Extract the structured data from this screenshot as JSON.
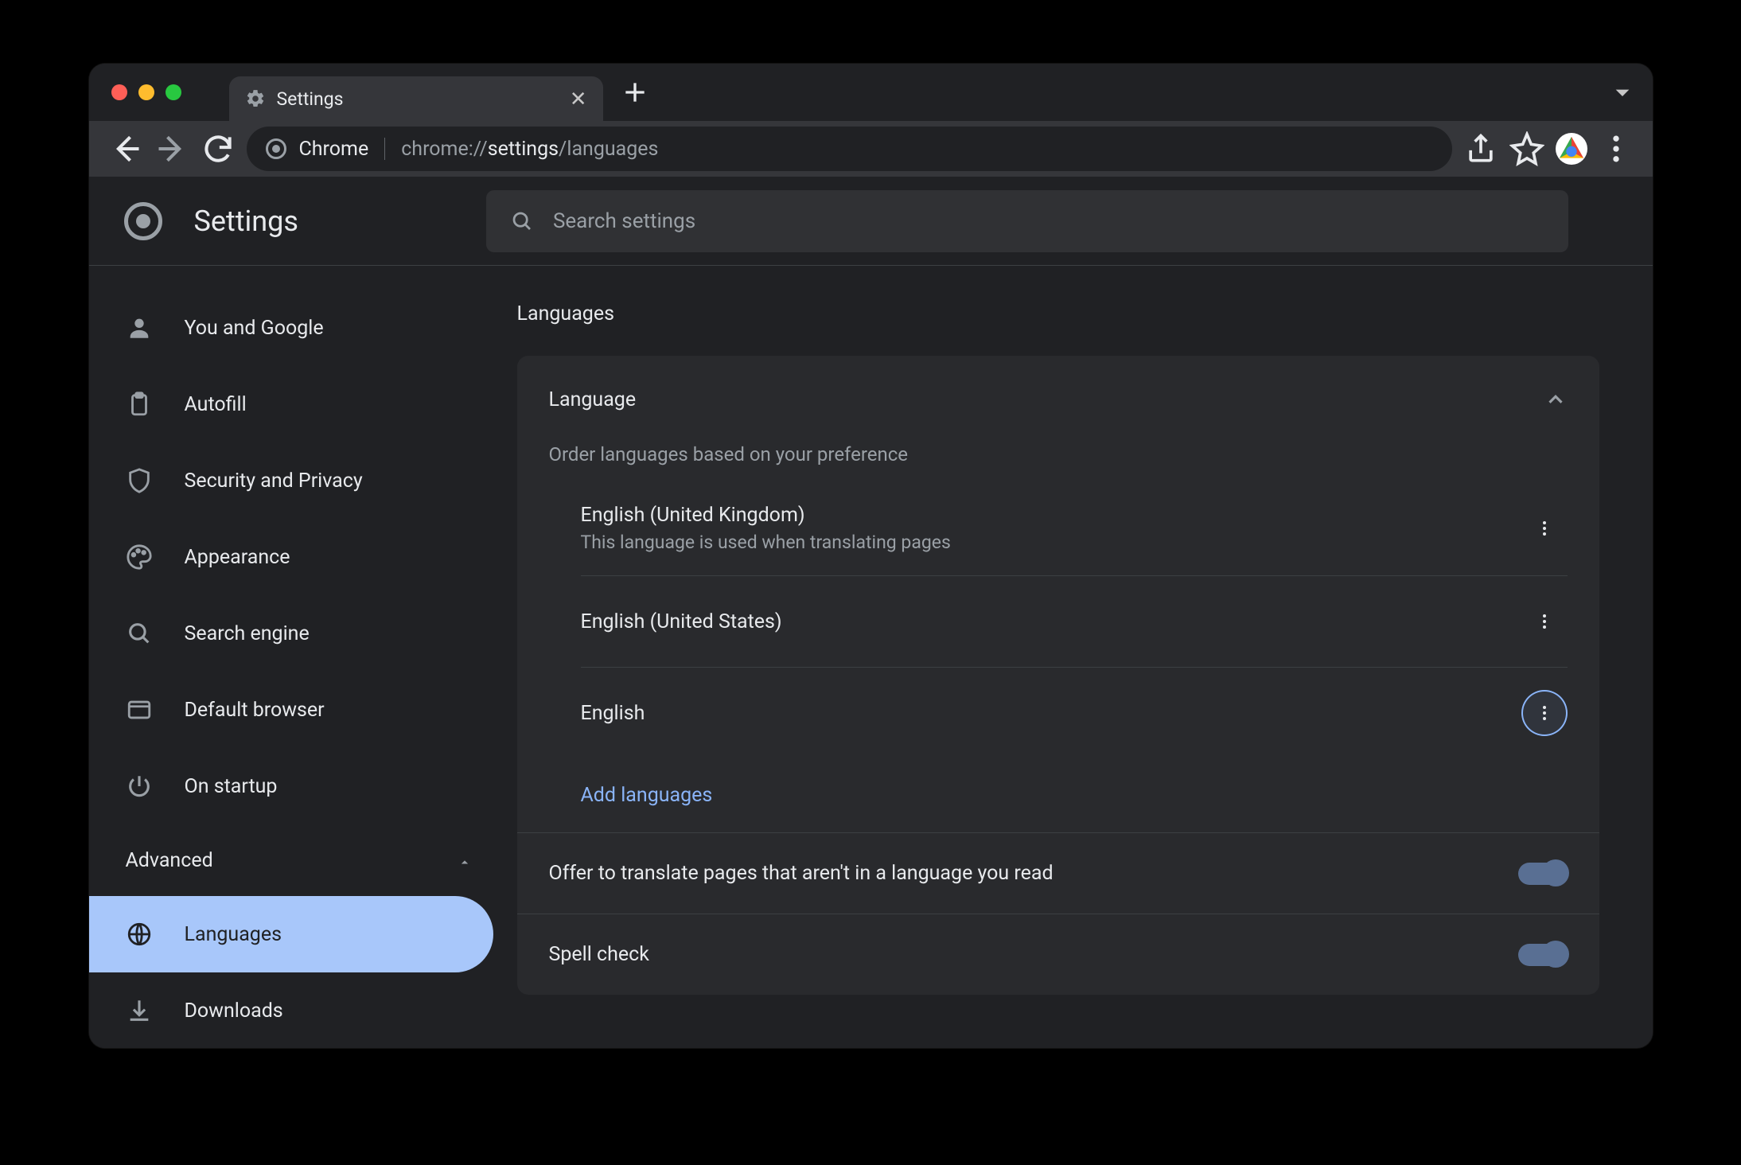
{
  "window": {
    "tab_title": "Settings",
    "new_tab_tooltip": "+"
  },
  "omnibox": {
    "origin_label": "Chrome",
    "url_scheme": "chrome://",
    "url_path_bold": "settings",
    "url_path_tail": "/languages"
  },
  "page": {
    "app_title": "Settings",
    "search_placeholder": "Search settings"
  },
  "sidebar": {
    "items": [
      {
        "label": "You and Google"
      },
      {
        "label": "Autofill"
      },
      {
        "label": "Security and Privacy"
      },
      {
        "label": "Appearance"
      },
      {
        "label": "Search engine"
      },
      {
        "label": "Default browser"
      },
      {
        "label": "On startup"
      }
    ],
    "advanced_label": "Advanced",
    "advanced_items": [
      {
        "label": "Languages",
        "active": true
      },
      {
        "label": "Downloads"
      }
    ]
  },
  "content": {
    "section_title": "Languages",
    "language_card": {
      "header": "Language",
      "order_hint": "Order languages based on your preference",
      "languages": [
        {
          "name": "English (United Kingdom)",
          "desc": "This language is used when translating pages"
        },
        {
          "name": "English (United States)",
          "desc": ""
        },
        {
          "name": "English",
          "desc": ""
        }
      ],
      "add_label": "Add languages",
      "translate_row": "Offer to translate pages that aren't in a language you read",
      "spell_row": "Spell check"
    }
  }
}
